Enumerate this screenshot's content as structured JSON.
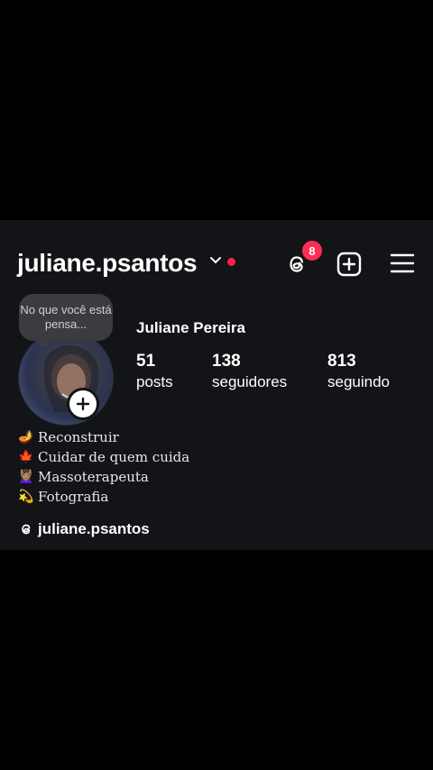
{
  "header": {
    "username": "juliane.psantos",
    "threads_badge": "8"
  },
  "profile": {
    "note_text": "No que você está pensa...",
    "full_name": "Juliane Pereira",
    "stats": [
      {
        "value": "51",
        "label": "posts"
      },
      {
        "value": "138",
        "label": "seguidores"
      },
      {
        "value": "813",
        "label": "seguindo"
      }
    ]
  },
  "bio": [
    {
      "emoji": "🪔",
      "text": "Reconstruir"
    },
    {
      "emoji": "🍁",
      "text": "Cuidar de quem cuida"
    },
    {
      "emoji": "💆🏽‍♀️",
      "text": "Massoterapeuta"
    },
    {
      "emoji": "💫",
      "text": "Fotografia"
    }
  ],
  "threads_link": "juliane.psantos",
  "colors": {
    "background": "#121417",
    "badge": "#ff2d55",
    "dot": "#ff1f4b"
  }
}
